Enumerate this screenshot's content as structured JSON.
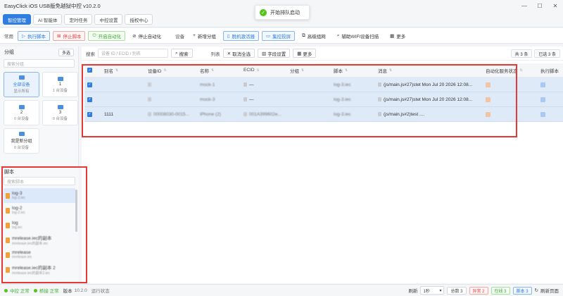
{
  "app": {
    "title": "EasyClick iOS USB版免越狱中控 v10.2.0"
  },
  "window": {
    "minimize": "—",
    "maximize": "☐",
    "close": "✕"
  },
  "toast": {
    "text": "开始排队启动"
  },
  "tabs": [
    "智控管理",
    "AI 智能体",
    "定时任务",
    "中控设置",
    "授权中心"
  ],
  "toolbar": {
    "label_common": "常用",
    "run_script": "执行脚本",
    "stop_script": "停止脚本",
    "start_auto": "开启自动化",
    "stop_auto": "停止自动化",
    "label_device": "设备",
    "add_group": "新增分组",
    "activator": "脱机激活器",
    "mirror": "集控投屏",
    "advanced": "高级组网",
    "wifi_scan": "辅助WIFI设备扫描",
    "more": "更多"
  },
  "sidebar": {
    "groups_title": "分组",
    "multi_select": "多选",
    "search_placeholder": "搜索分组",
    "groups": [
      {
        "name": "全部设备",
        "sub": "显示所有"
      },
      {
        "name": "1",
        "sub": "1 台设备"
      },
      {
        "name": "2",
        "sub": "0 台设备"
      },
      {
        "name": "3",
        "sub": "0 台设备"
      },
      {
        "name": "我是新分组",
        "sub": "0 台设备"
      }
    ],
    "scripts_title": "脚本",
    "scripts_search_placeholder": "搜索脚本",
    "scripts": [
      {
        "name": "log-3",
        "file": "log-3.iec"
      },
      {
        "name": "log-2",
        "file": "log-2.iec"
      },
      {
        "name": "log",
        "file": "log.iec"
      },
      {
        "name": "mrelease.iec的副本",
        "file": "mrelease.iec的副本.iec"
      },
      {
        "name": "mrelease",
        "file": "mrelease.iec"
      },
      {
        "name": "mrelease.iec的副本 2",
        "file": "mrelease.iec的副本2.iec"
      }
    ]
  },
  "search": {
    "label": "搜索",
    "placeholder": "设备 ID / ECID / 别名",
    "button": "搜索",
    "label_list": "列表",
    "deselect_all": "取消全选",
    "field_settings": "字段设置",
    "more": "更多",
    "total": "共 3 条",
    "selected": "已选 3 条"
  },
  "grid": {
    "headers": [
      "别名",
      "设备ID",
      "名称",
      "ECID",
      "分组",
      "脚本",
      "消息",
      "自动化服务状态",
      "执行脚本"
    ],
    "rows": [
      {
        "alias": "",
        "device_id": "",
        "name": "mock-1",
        "ecid": "—",
        "group": "",
        "script": "log-3.iec",
        "message": "(js/main.js#27)stet Mon Jul 20 2026 12:08..."
      },
      {
        "alias": "",
        "device_id": "",
        "name": "mock-3",
        "ecid": "—",
        "group": "",
        "script": "log-3.iec",
        "message": "(js/main.js#27)stet Mon Jul 20 2026 12:08..."
      },
      {
        "alias": "1111",
        "device_id": "00008030-0015...",
        "name": "iPhone (2)",
        "ecid": "001A399602e...",
        "group": "",
        "script": "log-3.iec",
        "message": "(js/main.js#2)test ...."
      }
    ]
  },
  "statusbar": {
    "control": "中控 正常",
    "bridge": "桥接 正常",
    "version_label": "版本",
    "version": "10.2.0",
    "run_status": "运行状态",
    "refresh_label": "刷新",
    "interval": "1秒",
    "total": "总数 3",
    "abnormal": "异常 2",
    "online": "在线 3",
    "script": "脚本 3",
    "refresh_page": "刷新页面"
  },
  "colors": {
    "accent": "#2f7de1",
    "highlight": "#e53935",
    "row_selected": "#dfeaf8"
  }
}
